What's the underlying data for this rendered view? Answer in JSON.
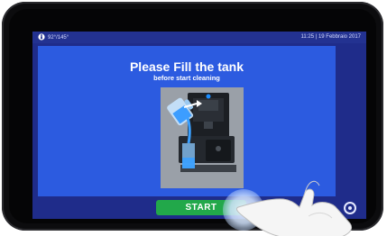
{
  "status_bar": {
    "temperature": "92°/145°",
    "datetime": "11:25 | 19 Febbraio 2017"
  },
  "dialog": {
    "title": "Please Fill the tank",
    "subtitle": "before start cleaning"
  },
  "actions": {
    "start_label": "START"
  },
  "icons": {
    "status": "thermometer-icon",
    "home": "home-icon"
  },
  "colors": {
    "screen_bg": "#1f2c8a",
    "panel_bg": "#2c5be0",
    "start_button": "#22a84a"
  }
}
